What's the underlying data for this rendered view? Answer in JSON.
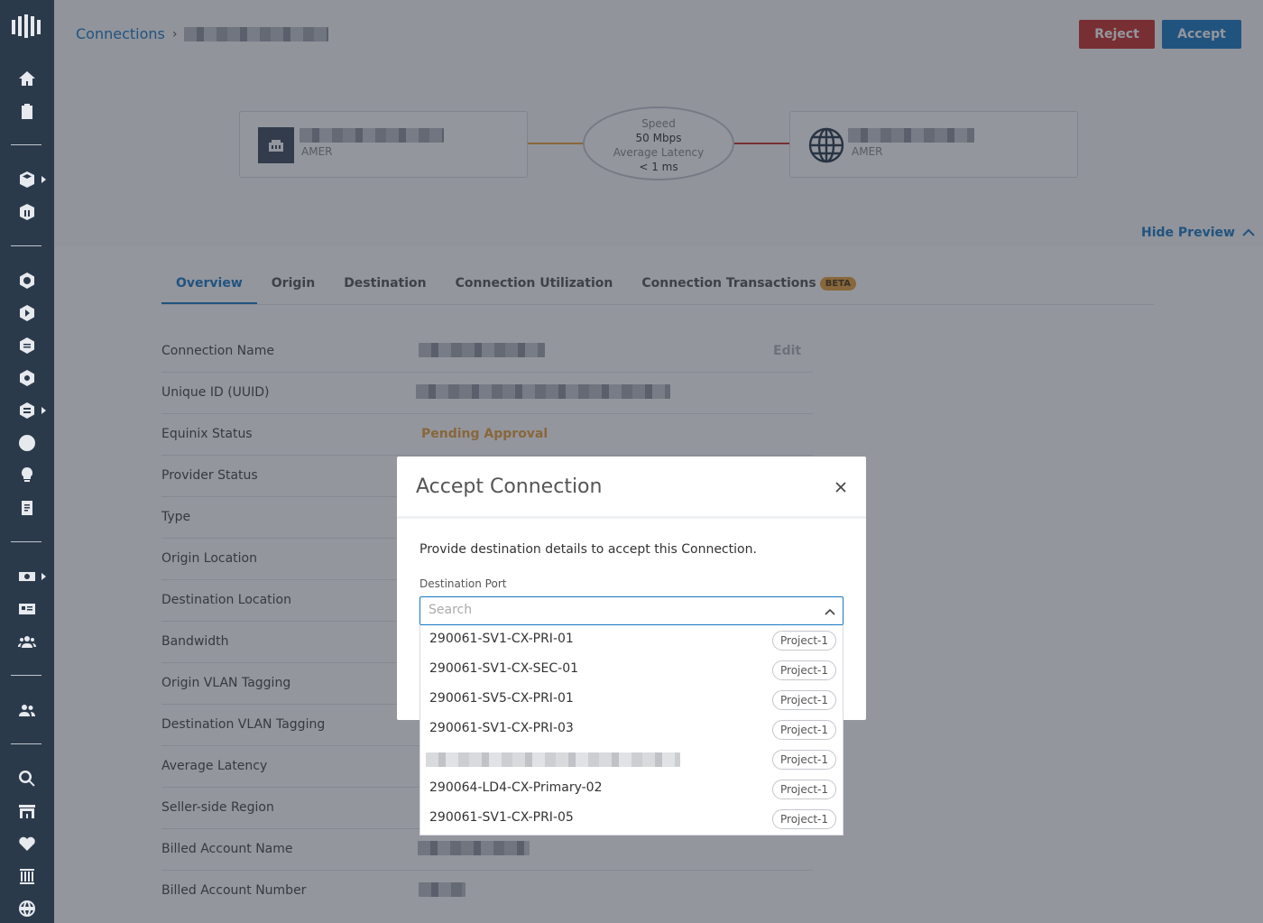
{
  "breadcrumb": {
    "root": "Connections",
    "separator": "›"
  },
  "actions": {
    "reject": "Reject",
    "accept": "Accept"
  },
  "preview": {
    "origin_region": "AMER",
    "destination_region": "AMER",
    "speed_label": "Speed",
    "speed_value": "50 Mbps",
    "latency_label": "Average Latency",
    "latency_value": "< 1 ms",
    "hide_preview": "Hide Preview",
    "colors": {
      "origin_link": "#e8a13a",
      "destination_link": "#c8302b"
    }
  },
  "tabs": [
    {
      "label": "Overview",
      "active": true
    },
    {
      "label": "Origin"
    },
    {
      "label": "Destination"
    },
    {
      "label": "Connection Utilization"
    },
    {
      "label": "Connection Transactions",
      "badge": "BETA"
    }
  ],
  "details": {
    "rows": [
      {
        "label": "Connection Name",
        "action": "Edit"
      },
      {
        "label": "Unique ID (UUID)"
      },
      {
        "label": "Equinix Status",
        "value": "Pending Approval"
      },
      {
        "label": "Provider Status"
      },
      {
        "label": "Type"
      },
      {
        "label": "Origin Location"
      },
      {
        "label": "Destination Location"
      },
      {
        "label": "Bandwidth"
      },
      {
        "label": "Origin VLAN Tagging"
      },
      {
        "label": "Destination VLAN Tagging"
      },
      {
        "label": "Average Latency"
      },
      {
        "label": "Seller-side Region"
      },
      {
        "label": "Billed Account Name"
      },
      {
        "label": "Billed Account Number"
      }
    ]
  },
  "modal": {
    "title": "Accept Connection",
    "description": "Provide destination details to accept this Connection.",
    "field_label": "Destination Port",
    "search_placeholder": "Search",
    "options": [
      {
        "label": "290061-SV1-CX-PRI-01",
        "project": "Project-1"
      },
      {
        "label": "290061-SV1-CX-SEC-01",
        "project": "Project-1"
      },
      {
        "label": "290061-SV5-CX-PRI-01",
        "project": "Project-1"
      },
      {
        "label": "290061-SV1-CX-PRI-03",
        "project": "Project-1"
      },
      {
        "label": "",
        "project": "Project-1"
      },
      {
        "label": "290064-LD4-CX-Primary-02",
        "project": "Project-1"
      },
      {
        "label": "290061-SV1-CX-PRI-05",
        "project": "Project-1"
      }
    ]
  },
  "sidebar_icons": [
    "equinix-logo",
    "home-icon",
    "clipboard-icon",
    "cube-stack-icon",
    "building-icon",
    "hexagon-network-icon",
    "hexagon-arrow-icon",
    "hexagon-layers-icon",
    "hexagon-gear-icon",
    "hexagon-menu-icon",
    "clock-icon",
    "lightbulb-icon",
    "document-icon",
    "money-icon",
    "id-card-icon",
    "users-icon",
    "team-icon",
    "search-icon",
    "store-icon",
    "heartbeat-icon",
    "columns-icon",
    "globe-icon"
  ],
  "brand_colors": {
    "primary": "#1a78c2",
    "danger": "#c8302b",
    "warning": "#e8a13a",
    "sidebar": "#2b3a4b"
  }
}
